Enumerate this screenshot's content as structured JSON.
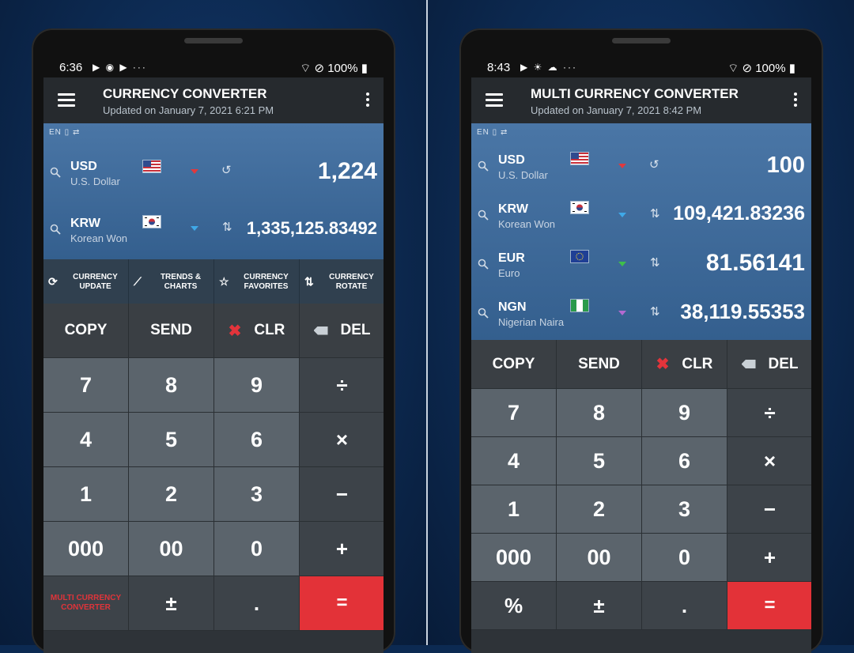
{
  "left": {
    "status": {
      "time": "6:36",
      "icons": "▶ ◉ ▶ ···",
      "battery": "100%"
    },
    "appbar": {
      "title": "CURRENCY CONVERTER",
      "subtitle": "Updated on January 7, 2021 6:21 PM"
    },
    "lang": "EN",
    "currencies": [
      {
        "code": "USD",
        "name": "U.S. Dollar",
        "value": "1,224",
        "flag": "us",
        "arrow_color": "#e0393e",
        "action_icon": "history-icon"
      },
      {
        "code": "KRW",
        "name": "Korean Won",
        "value": "1,335,125.83492",
        "flag": "kr",
        "arrow_color": "#3fa9e8",
        "action_icon": "swap-icon"
      }
    ],
    "tools": [
      {
        "label": "CURRENCY UPDATE",
        "icon": "refresh-icon",
        "glyph": "⟳"
      },
      {
        "label": "TRENDS & CHARTS",
        "icon": "trend-icon",
        "glyph": "⟋"
      },
      {
        "label": "CURRENCY FAVORITES",
        "icon": "star-icon",
        "glyph": "☆"
      },
      {
        "label": "CURRENCY ROTATE",
        "icon": "rotate-icon",
        "glyph": "⇅"
      }
    ],
    "actions": {
      "copy": "COPY",
      "send": "SEND",
      "clr": "CLR",
      "del": "DEL"
    },
    "keys": [
      [
        "7",
        "8",
        "9",
        "÷"
      ],
      [
        "4",
        "5",
        "6",
        "×"
      ],
      [
        "1",
        "2",
        "3",
        "−"
      ],
      [
        "000",
        "00",
        "0",
        "+"
      ]
    ],
    "bottom": {
      "multi": "MULTI CURRENCY CONVERTER",
      "plusminus": "±",
      "dot": ".",
      "equals": "="
    }
  },
  "right": {
    "status": {
      "time": "8:43",
      "icons": "▶ ☀ ☁ ···",
      "battery": "100%"
    },
    "appbar": {
      "title": "MULTI CURRENCY CONVERTER",
      "subtitle": "Updated on January 7, 2021 8:42 PM"
    },
    "lang": "EN",
    "currencies": [
      {
        "code": "USD",
        "name": "U.S. Dollar",
        "value": "100",
        "flag": "us",
        "arrow_color": "#e0393e",
        "action_icon": "history-icon"
      },
      {
        "code": "KRW",
        "name": "Korean Won",
        "value": "109,421.83236",
        "flag": "kr",
        "arrow_color": "#3fa9e8",
        "action_icon": "swap-icon"
      },
      {
        "code": "EUR",
        "name": "Euro",
        "value": "81.56141",
        "flag": "eu",
        "arrow_color": "#3fbf4a",
        "action_icon": "swap-icon"
      },
      {
        "code": "NGN",
        "name": "Nigerian Naira",
        "value": "38,119.55353",
        "flag": "ng",
        "arrow_color": "#b36ad0",
        "action_icon": "swap-icon"
      }
    ],
    "actions": {
      "copy": "COPY",
      "send": "SEND",
      "clr": "CLR",
      "del": "DEL"
    },
    "keys": [
      [
        "7",
        "8",
        "9",
        "÷"
      ],
      [
        "4",
        "5",
        "6",
        "×"
      ],
      [
        "1",
        "2",
        "3",
        "−"
      ],
      [
        "000",
        "00",
        "0",
        "+"
      ]
    ],
    "bottom": {
      "percent": "%",
      "plusminus": "±",
      "dot": ".",
      "equals": "="
    }
  }
}
